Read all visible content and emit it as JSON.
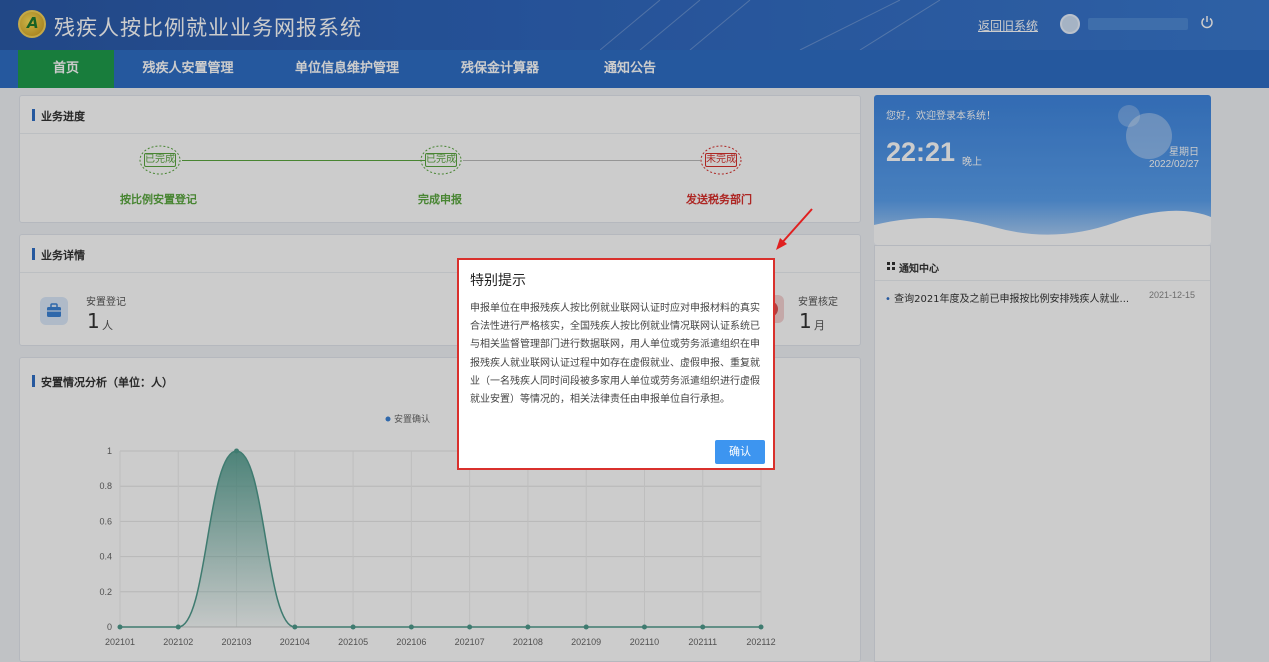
{
  "header": {
    "title": "残疾人按比例就业业务网报系统",
    "back_link": "返回旧系统"
  },
  "nav": [
    "首页",
    "残疾人安置管理",
    "单位信息维护管理",
    "残保金计算器",
    "通知公告"
  ],
  "progress": {
    "title": "业务进度",
    "steps": [
      {
        "stamp": "已完成",
        "label": "按比例安置登记"
      },
      {
        "stamp": "已完成",
        "label": "完成申报"
      },
      {
        "stamp": "未完成",
        "label": "发送税务部门"
      }
    ]
  },
  "details": {
    "title": "业务详情",
    "left": {
      "label": "安置登记",
      "value": "1",
      "unit": "人"
    },
    "right": {
      "label": "安置核定",
      "value": "1",
      "unit": "月"
    }
  },
  "analysis": {
    "title": "安置情况分析（单位：人）"
  },
  "chart_data": {
    "type": "area",
    "title": "",
    "legend": [
      "安置确认"
    ],
    "categories": [
      "202101",
      "202102",
      "202103",
      "202104",
      "202105",
      "202106",
      "202107",
      "202108",
      "202109",
      "202110",
      "202111",
      "202112"
    ],
    "series": [
      {
        "name": "安置确认",
        "values": [
          0,
          0,
          1,
          0,
          0,
          0,
          0,
          0,
          0,
          0,
          0,
          0
        ]
      }
    ],
    "ylim": [
      0,
      1
    ],
    "yticks": [
      "0",
      "0.2",
      "0.4",
      "0.6",
      "0.8",
      "1"
    ],
    "grid": true
  },
  "welcome": {
    "greeting": "您好，欢迎登录本系统！",
    "time": "22:21",
    "ampm": "晚上",
    "weekday": "星期日",
    "date": "2022/02/27"
  },
  "notice": {
    "title": "通知中心",
    "items": [
      {
        "text": "查询2021年度及之前已申报按比例安排残疾人就业...",
        "date": "2021-12-15"
      }
    ]
  },
  "modal": {
    "title": "特别提示",
    "body": "申报单位在申报残疾人按比例就业联网认证时应对申报材料的真实合法性进行严格核实，全国残疾人按比例就业情况联网认证系统已与相关监督管理部门进行数据联网，用人单位或劳务派遣组织在申报残疾人就业联网认证过程中如存在虚假就业、虚假申报、重复就业（一名残疾人同时间段被多家用人单位或劳务派遣组织进行虚假就业安置）等情况的，相关法律责任由申报单位自行承担。",
    "ok_label": "确认"
  },
  "colors": {
    "accent": "#2f6fc6",
    "active_nav": "#1f9d4c",
    "done": "#5aa73f",
    "pending": "#d9302c",
    "series": "#4f9a8c"
  }
}
